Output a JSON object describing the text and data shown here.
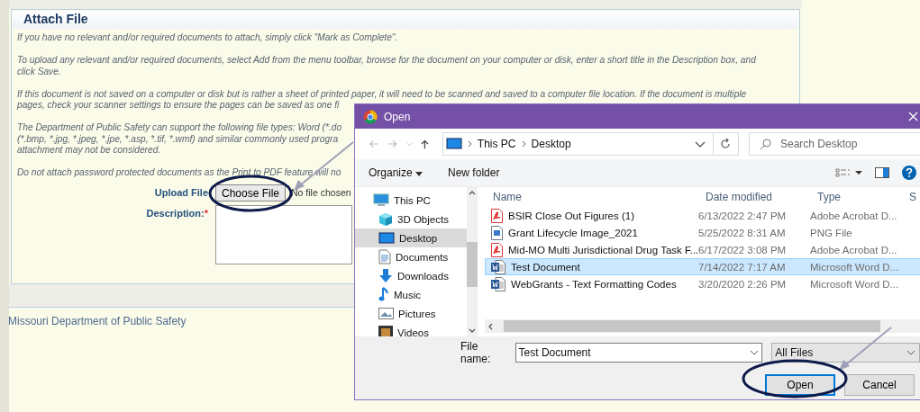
{
  "card": {
    "title": "Attach File",
    "paragraphs": [
      {
        "lines": [
          "If you have no relevant and/or required documents to attach, simply click \"Mark as Complete\"."
        ]
      },
      {
        "lines": [
          "To upload any relevant and/or required documents, select Add from the menu toolbar, browse for the document on your computer or disk, enter a short title in the Description box, and",
          "click Save."
        ]
      },
      {
        "lines": [
          "If this document is not saved on a computer or disk but is rather a sheet of printed paper, it will need to be scanned and saved to a computer file location. If the document is multiple",
          "pages, check your scanner settings to ensure the pages can be saved as one fi"
        ]
      },
      {
        "lines": [
          "The Department of Public Safety can support the following file types: Word (*.do",
          "(*.bmp, *.jpg, *.jpeg, *.jpe, *.asp, *.tif, *.wmf) and similar commonly used progra",
          "attachment may not be considered."
        ]
      },
      {
        "lines": [
          "Do not attach password protected documents as the Print to PDF feature will no"
        ]
      }
    ],
    "upload": {
      "label": "Upload File",
      "button": "Choose File",
      "status": "No file chosen"
    },
    "description": {
      "label": "Description:",
      "required_mark": "*"
    }
  },
  "footer": "Missouri Department of Public Safety",
  "dialog": {
    "title": "Open",
    "breadcrumb": [
      "This PC",
      "Desktop"
    ],
    "search_placeholder": "Search Desktop",
    "toolbar": [
      "Organize",
      "New folder"
    ],
    "nav": [
      {
        "label": "This PC",
        "kind": "pc",
        "selected": false,
        "children": [
          {
            "label": "3D Objects",
            "kind": "objects",
            "selected": false
          },
          {
            "label": "Desktop",
            "kind": "desktop",
            "selected": true
          },
          {
            "label": "Documents",
            "kind": "documents",
            "selected": false
          },
          {
            "label": "Downloads",
            "kind": "downloads",
            "selected": false
          },
          {
            "label": "Music",
            "kind": "music",
            "selected": false
          },
          {
            "label": "Pictures",
            "kind": "pictures",
            "selected": false
          },
          {
            "label": "Videos",
            "kind": "videos",
            "selected": false
          }
        ]
      }
    ],
    "columns": [
      "Name",
      "Date modified",
      "Type",
      "S"
    ],
    "files": [
      {
        "name": "BSIR Close Out Figures (1)",
        "date": "6/13/2022 2:47 PM",
        "type": "Adobe Acrobat D...",
        "kind": "pdf",
        "selected": false
      },
      {
        "name": "Grant Lifecycle Image_2021",
        "date": "5/25/2022 8:31 AM",
        "type": "PNG File",
        "kind": "png",
        "selected": false
      },
      {
        "name": "Mid-MO Multi Jurisdictional Drug Task F...",
        "date": "6/17/2022 3:08 PM",
        "type": "Adobe Acrobat D...",
        "kind": "pdf",
        "selected": false
      },
      {
        "name": "Test Document",
        "date": "7/14/2022 7:17 AM",
        "type": "Microsoft Word D...",
        "kind": "word",
        "selected": true
      },
      {
        "name": "WebGrants - Text Formatting Codes",
        "date": "3/20/2020 2:26 PM",
        "type": "Microsoft Word D...",
        "kind": "word",
        "selected": false
      }
    ],
    "file_name_label": "File name:",
    "file_name": "Test Document",
    "filter": "All Files",
    "buttons": [
      "Open",
      "Cancel"
    ]
  }
}
